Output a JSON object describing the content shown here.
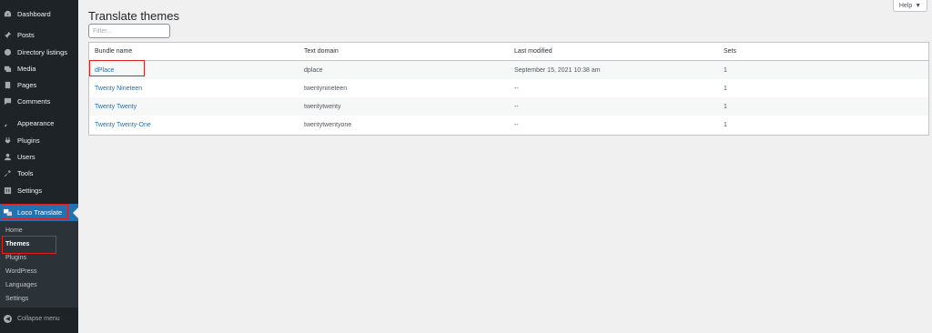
{
  "sidebar": {
    "items": [
      {
        "label": "Dashboard",
        "icon": "dashboard-icon"
      },
      {
        "label": "Posts",
        "icon": "pin-icon"
      },
      {
        "label": "Directory listings",
        "icon": "directory-icon"
      },
      {
        "label": "Media",
        "icon": "media-icon"
      },
      {
        "label": "Pages",
        "icon": "pages-icon"
      },
      {
        "label": "Comments",
        "icon": "comments-icon"
      },
      {
        "label": "Appearance",
        "icon": "appearance-icon"
      },
      {
        "label": "Plugins",
        "icon": "plugins-icon"
      },
      {
        "label": "Users",
        "icon": "users-icon"
      },
      {
        "label": "Tools",
        "icon": "tools-icon"
      },
      {
        "label": "Settings",
        "icon": "settings-icon"
      }
    ],
    "active": {
      "label": "Loco Translate",
      "icon": "loco-translate-icon"
    },
    "submenu": [
      "Home",
      "Themes",
      "Plugins",
      "WordPress",
      "Languages",
      "Settings"
    ],
    "submenu_active": "Themes",
    "collapse_label": "Collapse menu"
  },
  "page": {
    "title": "Translate themes",
    "filter_placeholder": "Filter...",
    "help_label": "Help"
  },
  "table": {
    "columns": [
      "Bundle name",
      "Text domain",
      "Last modified",
      "Sets"
    ],
    "rows": [
      {
        "bundle": "dPlace",
        "domain": "dplace",
        "modified": "September 15, 2021 10:38 am",
        "sets": "1"
      },
      {
        "bundle": "Twenty Nineteen",
        "domain": "twentynineteen",
        "modified": "--",
        "sets": "1"
      },
      {
        "bundle": "Twenty Twenty",
        "domain": "twentytwenty",
        "modified": "--",
        "sets": "1"
      },
      {
        "bundle": "Twenty Twenty-One",
        "domain": "twentytwentyone",
        "modified": "--",
        "sets": "1"
      }
    ]
  },
  "colors": {
    "sidebar": "#1d2327",
    "accent": "#2271b1",
    "highlight": "#e0201c",
    "link": "#2271b1"
  }
}
